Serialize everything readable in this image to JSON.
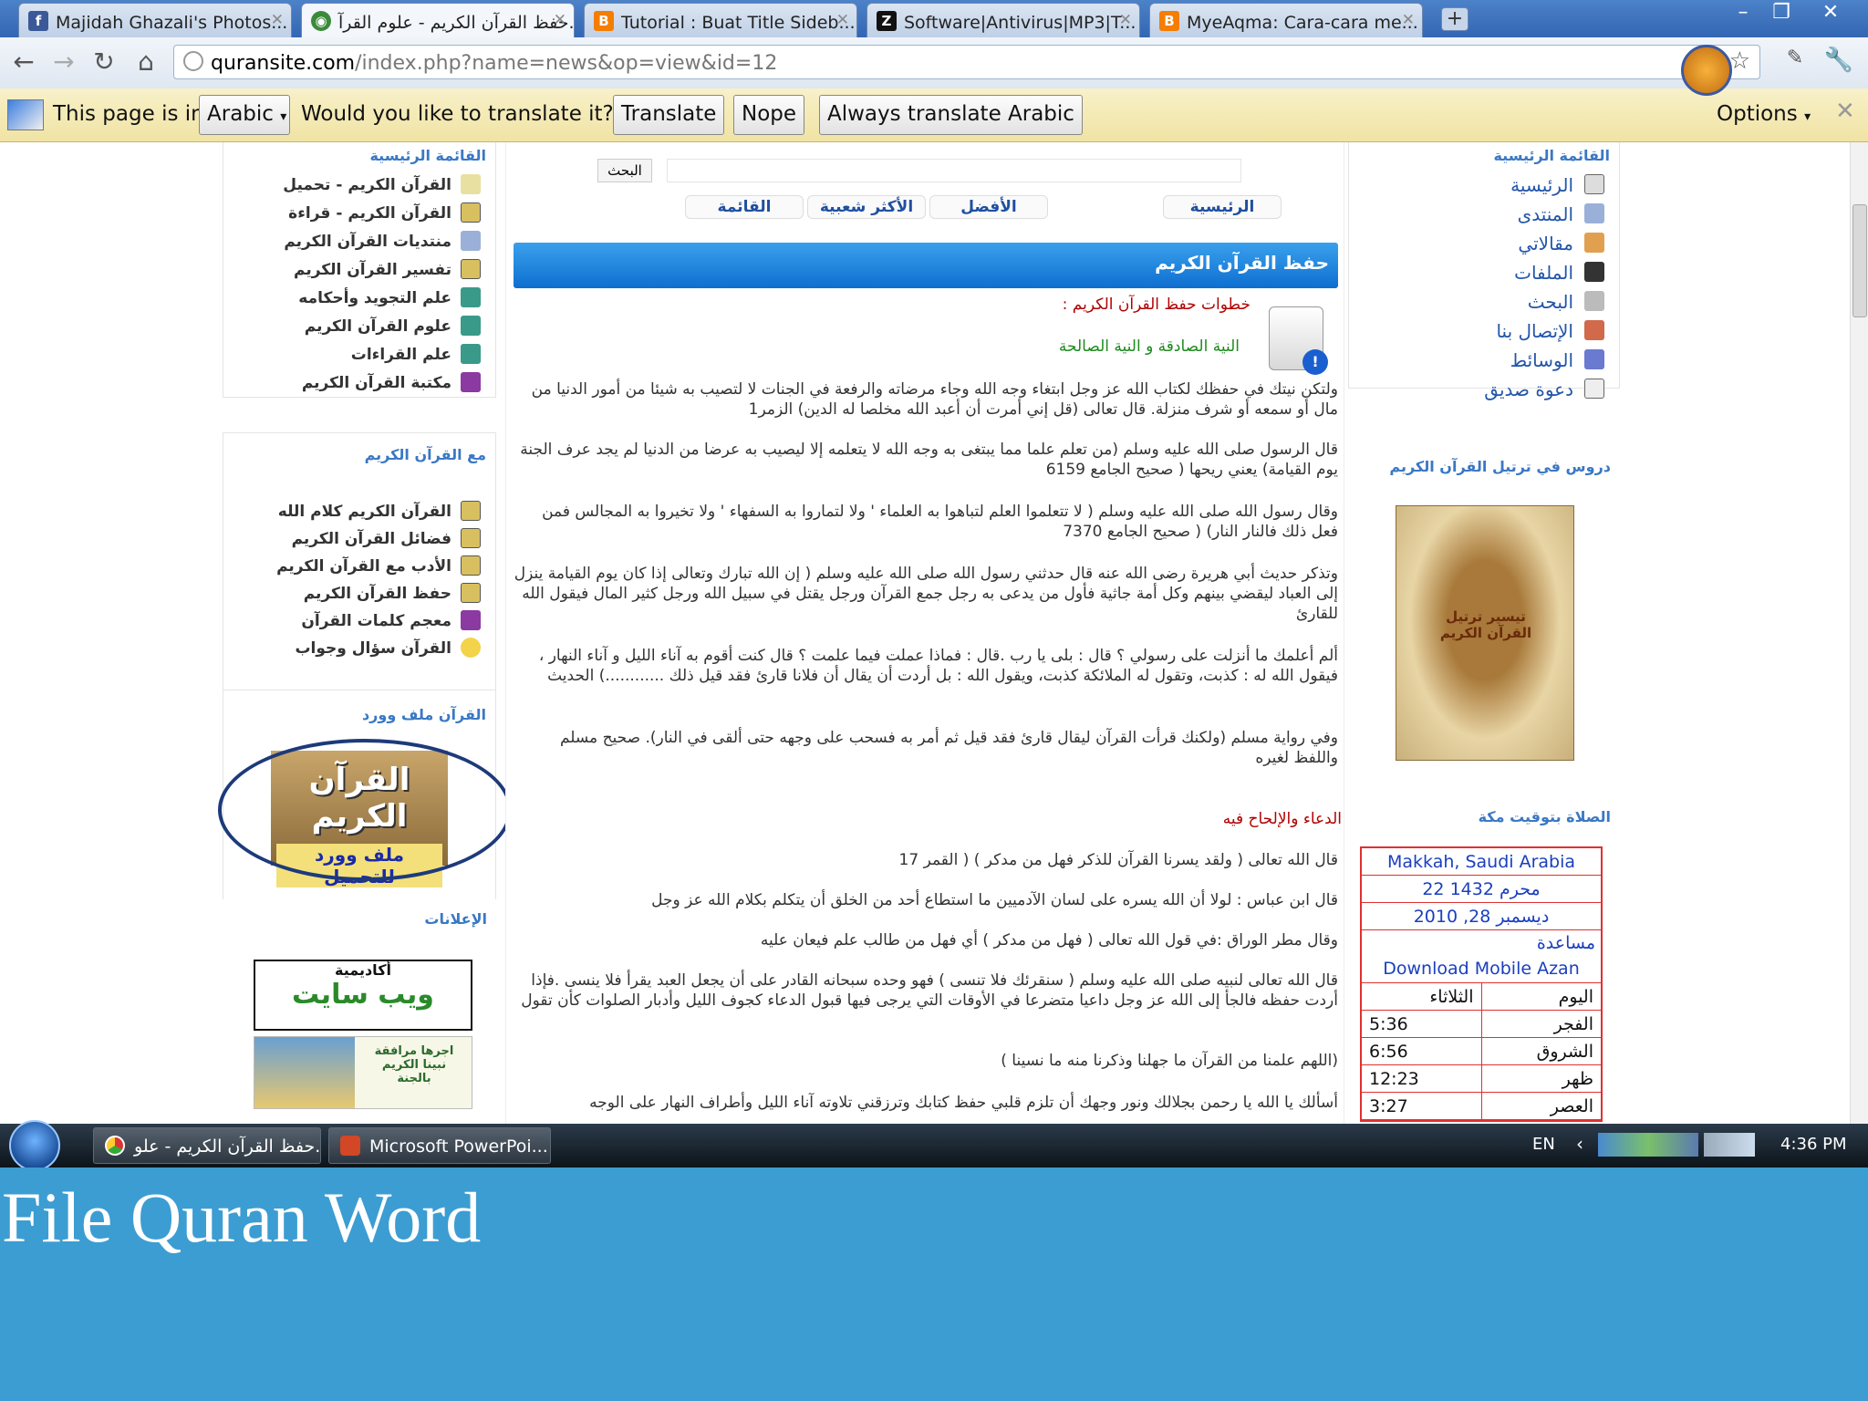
{
  "browser": {
    "tabs": [
      {
        "label": "Majidah Ghazali's Photos...",
        "icon": "facebook-icon",
        "icon_color": "#3b5998"
      },
      {
        "label": "حفظ القرآن الكريم - علوم القرآ...",
        "icon": "globe-icon",
        "icon_color": "#3a8a3a"
      },
      {
        "label": "Tutorial : Buat Title Sideb...",
        "icon": "blogger-icon",
        "icon_color": "#f57d00"
      },
      {
        "label": "Software|Antivirus|MP3|T...",
        "icon": "z-icon",
        "icon_color": "#111111"
      },
      {
        "label": "MyeAqma: Cara-cara me...",
        "icon": "blogger-icon",
        "icon_color": "#f57d00"
      }
    ],
    "url_domain": "quransite.com",
    "url_path": "/index.php?name=news&op=view&id=12"
  },
  "translate_bar": {
    "prefix": "This page is in",
    "language": "Arabic",
    "question": "Would you like to translate it?",
    "translate_btn": "Translate",
    "nope_btn": "Nope",
    "always_btn": "Always translate Arabic",
    "options": "Options"
  },
  "left_sidebar": {
    "menu_title": "القائمة الرئيسية",
    "menu": [
      {
        "label": "القرآن الكريم - تحميل",
        "icon": "speaker-icon"
      },
      {
        "label": "القرآن الكريم - قراءة",
        "icon": "document-icon"
      },
      {
        "label": "منتديات القرآن الكريم",
        "icon": "server-icon"
      },
      {
        "label": "تفسير القرآن الكريم",
        "icon": "document-icon"
      },
      {
        "label": "علم التجويد وأحكامه",
        "icon": "book-icon"
      },
      {
        "label": "علوم القرآن الكريم",
        "icon": "book-icon"
      },
      {
        "label": "علم القراءات",
        "icon": "book-icon"
      },
      {
        "label": "مكتبة القرآن الكريم",
        "icon": "book-purple-icon"
      }
    ],
    "with_quran_title": "مع القرآن الكريم",
    "with_quran": [
      {
        "label": "القرآن الكريم كلام الله",
        "icon": "document-icon"
      },
      {
        "label": "فضائل القرآن الكريم",
        "icon": "document-icon"
      },
      {
        "label": "الأدب مع القرآن الكريم",
        "icon": "document-icon"
      },
      {
        "label": "حفظ القرآن الكريم",
        "icon": "document-icon"
      },
      {
        "label": "معجم كلمات القرآن",
        "icon": "book-purple-icon"
      },
      {
        "label": "القرآن سؤال وجواب",
        "icon": "bulb-icon"
      }
    ],
    "word_file_title": "القرآن ملف وورد",
    "word_banner_top": "القرآن الكريم",
    "word_banner_bottom": "ملف وورد للتحميل",
    "ads_title": "الإعلانات",
    "ad1_top": "أكاديمية",
    "ad1_main": "ويب سايت",
    "ad2_text": "اجرها مرافقة نبينا الكريم بالجنة"
  },
  "center": {
    "search_button": "البحث",
    "nav_tabs": [
      "الرئيسية",
      "الأفضل",
      "الأكثر شعبية",
      "القائمة"
    ],
    "article_title": "حفظ القرآن الكريم",
    "steps_heading": "خطوات حفظ القرآن الكريم :",
    "intention_heading": "النية الصادقة و النية الصالحة",
    "paragraphs": [
      "ولتكن نيتك في حفظك لكتاب الله عز وجل ابتغاء وجه الله وجاء مرضاته والرفعة في الجنات لا لتصيب به شيئا من أمور الدنيا من مال أو سمعه أو شرف منزلة. قال تعالى (قل إني أمرت أن أعبد الله مخلصا له الدين) الزمر1",
      "قال الرسول صلى الله عليه وسلم (من تعلم علما مما يبتغى به وجه الله لا يتعلمه إلا ليصيب به عرضا من الدنيا لم يجد عرف الجنة يوم القيامة) يعني ريحها ( صحيح الجامع 6159",
      "وقال رسول الله صلى الله عليه وسلم ( لا تتعلموا العلم لتباهوا به العلماء ' ولا لتماروا به السفهاء ' ولا تخيروا به المجالس فمن فعل ذلك فالنار النار) ( صحيح الجامع 7370",
      "وتذكر حديث أبي هريرة رضى الله عنه قال حدثني رسول الله صلى الله عليه وسلم ( إن الله تبارك وتعالى إذا كان يوم القيامة ينزل إلى العباد ليقضي بينهم وكل أمة جاثية فأول من يدعى به رجل جمع القرآن ورجل يقتل في سبيل الله ورجل كثير المال فيقول الله للقارئ",
      "ألم أعلمك ما أنزلت على رسولي ؟ قال : بلى يا رب .قال : فماذا عملت فيما علمت ؟ قال كنت أقوم به آناء الليل و آناء النهار ، فيقول الله له : كذبت، وتقول له الملائكة كذبت، ويقول الله : بل أردت أن يقال أن فلانا قارئ فقد قيل ذلك ............) الحديث",
      "وفي رواية مسلم (ولكنك قرأت القرآن ليقال قارئ فقد قيل ثم أمر به فسحب على وجهه حتى ألقى في النار). صحيح مسلم واللفظ لغيره"
    ],
    "prayer_heading": "الدعاء والإلحاح فيه",
    "paragraphs2": [
      "قال الله تعالى ( ولقد يسرنا القرآن للذكر فهل من مدكر ) ( القمر 17",
      "قال ابن عباس : لولا أن الله يسره على لسان الآدميين ما استطاع أحد من الخلق أن يتكلم بكلام الله عز وجل",
      "وقال مطر الوراق :في قول الله تعالى ( فهل من مدكر ) أي فهل من طالب علم فيعان عليه",
      "قال الله تعالى لنبيه صلى الله عليه وسلم ( سنقرئك فلا تنسى ) فهو وحده سبحانه القادر على أن يجعل العبد يقرأ فلا ينسى .فإذا أردت حفظه فالجأ إلى الله عز وجل داعيا متضرعا في الأوقات التي يرجى فيها قبول الدعاء كجوف الليل وأدبار الصلوات كأن تقول",
      "(اللهم علمنا من القرآن ما جهلنا وذكرنا منه ما نسينا )",
      "أسألك يا الله يا رحمن بجلالك ونور وجهك أن تلزم قلبي حفظ كتابك وترزقني تلاوته آناء الليل وأطراف النهار على الوجه"
    ]
  },
  "right_sidebar": {
    "menu_title": "القائمة الرئيسية",
    "menu": [
      {
        "label": "الرئيسية",
        "icon": "home-icon"
      },
      {
        "label": "المنتدى",
        "icon": "server-icon"
      },
      {
        "label": "مقالاتي",
        "icon": "articles-icon"
      },
      {
        "label": "الملفات",
        "icon": "disk-icon"
      },
      {
        "label": "البحث",
        "icon": "search-icon"
      },
      {
        "label": "الإتصال بنا",
        "icon": "contact-icon"
      },
      {
        "label": "الوسائط",
        "icon": "media-icon"
      },
      {
        "label": "دعوة صديق",
        "icon": "invite-icon"
      }
    ],
    "lessons_title": "دروس في ترتيل القرآن الكريم",
    "book_title": "تيسير ترتيل القرآن الكريم",
    "prayer_title": "الصلاة بتوقيت مكة",
    "prayer": {
      "city": "Makkah, Saudi Arabia",
      "hijri": "22 محرم 1432",
      "gregorian": "ديسمبر 28, 2010",
      "help": "مساعدة",
      "download": "Download Mobile Azan",
      "rows": [
        {
          "label": "اليوم",
          "value": "الثلاثاء"
        },
        {
          "label": "الفجر",
          "value": "5:36"
        },
        {
          "label": "الشروق",
          "value": "6:56"
        },
        {
          "label": "ظهر",
          "value": "12:23"
        },
        {
          "label": "العصر",
          "value": "3:27"
        }
      ]
    }
  },
  "taskbar": {
    "items": [
      {
        "label": "حفظ القرآن الكريم - علو...",
        "icon": "chrome-icon"
      },
      {
        "label": "Microsoft PowerPoi...",
        "icon": "powerpoint-icon"
      }
    ],
    "lang": "EN",
    "time": "4:36 PM"
  },
  "caption": "File Quran Word"
}
